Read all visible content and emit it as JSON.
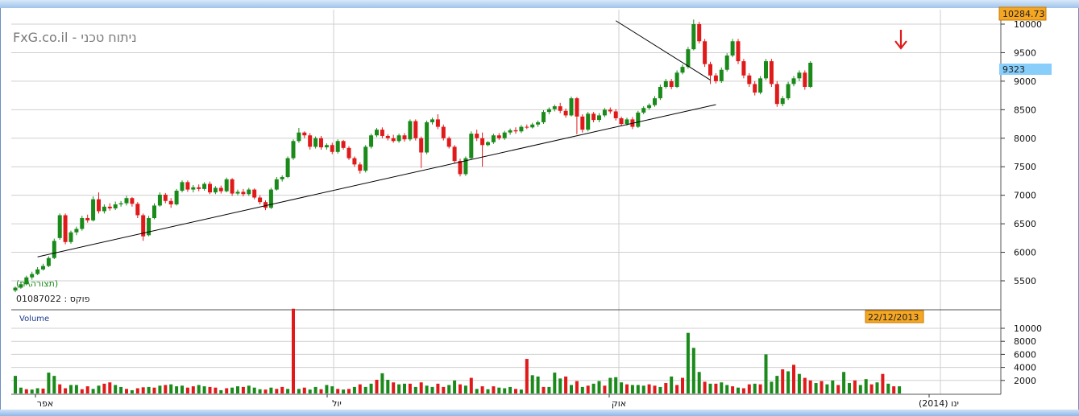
{
  "watermark": "FxG.co.il - ניתוח טכני",
  "price_tag": "10284.73",
  "last_value_tag": "9323",
  "date_tag": "22/12/2013",
  "legend_text": "(תצורה\\ית)",
  "symbol_line": "01087022 : פוקס",
  "volume_label": "Volume",
  "colors": {
    "up": "#1a8a1a",
    "down": "#e01a1a",
    "grid": "#cfcfcf",
    "tag_orange": "#f5a623",
    "tag_blue": "#87cefa",
    "arrow": "#e01a1a"
  },
  "chart_data": [
    {
      "type": "candlestick",
      "yticks": [
        5500,
        6000,
        6500,
        7000,
        7500,
        8000,
        8500,
        9000,
        9500,
        10000
      ],
      "ylim": [
        5000,
        10284.73
      ],
      "x_labels": [
        "אפר",
        "יול",
        "אוק",
        "(2014) ינו"
      ],
      "trendlines": [
        {
          "from": [
            4,
            5920
          ],
          "to": [
            126,
            8590
          ]
        },
        {
          "from": [
            108,
            10060
          ],
          "to": [
            125,
            9020
          ]
        }
      ],
      "candles": [
        [
          5330,
          5380,
          5300,
          5400
        ],
        [
          5380,
          5440,
          5360,
          5470
        ],
        [
          5440,
          5560,
          5420,
          5590
        ],
        [
          5560,
          5620,
          5520,
          5660
        ],
        [
          5620,
          5700,
          5600,
          5740
        ],
        [
          5700,
          5760,
          5680,
          5800
        ],
        [
          5760,
          5900,
          5740,
          5930
        ],
        [
          5900,
          6200,
          5880,
          6240
        ],
        [
          6250,
          6650,
          6220,
          6680
        ],
        [
          6650,
          6180,
          6140,
          6680
        ],
        [
          6180,
          6350,
          6150,
          6380
        ],
        [
          6350,
          6410,
          6300,
          6450
        ],
        [
          6410,
          6600,
          6380,
          6640
        ],
        [
          6600,
          6560,
          6520,
          6660
        ],
        [
          6560,
          6930,
          6540,
          6980
        ],
        [
          6930,
          6720,
          6680,
          7050
        ],
        [
          6720,
          6800,
          6680,
          6840
        ],
        [
          6800,
          6770,
          6730,
          6860
        ],
        [
          6770,
          6840,
          6740,
          6890
        ],
        [
          6840,
          6860,
          6800,
          6900
        ],
        [
          6860,
          6950,
          6820,
          6990
        ],
        [
          6950,
          6850,
          6800,
          6970
        ],
        [
          6850,
          6650,
          6600,
          6880
        ],
        [
          6650,
          6280,
          6200,
          6680
        ],
        [
          6300,
          6600,
          6280,
          6640
        ],
        [
          6600,
          6820,
          6580,
          6860
        ],
        [
          6820,
          7010,
          6800,
          7050
        ],
        [
          7010,
          6900,
          6860,
          7040
        ],
        [
          6900,
          6840,
          6780,
          6950
        ],
        [
          6840,
          7080,
          6820,
          7110
        ],
        [
          7080,
          7230,
          7050,
          7260
        ],
        [
          7230,
          7100,
          7060,
          7260
        ],
        [
          7100,
          7140,
          7050,
          7180
        ],
        [
          7140,
          7110,
          7070,
          7190
        ],
        [
          7110,
          7200,
          7080,
          7230
        ],
        [
          7200,
          7050,
          7020,
          7240
        ],
        [
          7050,
          7130,
          7020,
          7160
        ],
        [
          7130,
          7070,
          7030,
          7170
        ],
        [
          7070,
          7280,
          7050,
          7310
        ],
        [
          7280,
          7030,
          6990,
          7300
        ],
        [
          7030,
          7060,
          7000,
          7100
        ],
        [
          7060,
          7020,
          6980,
          7110
        ],
        [
          7020,
          7100,
          6990,
          7130
        ],
        [
          7100,
          6960,
          6930,
          7120
        ],
        [
          6960,
          6880,
          6840,
          7000
        ],
        [
          6880,
          6780,
          6740,
          6910
        ],
        [
          6780,
          7100,
          6760,
          7130
        ],
        [
          7100,
          7280,
          7080,
          7320
        ],
        [
          7280,
          7320,
          7240,
          7350
        ],
        [
          7320,
          7650,
          7300,
          7680
        ],
        [
          7650,
          7950,
          7620,
          7980
        ],
        [
          7950,
          8100,
          7920,
          8180
        ],
        [
          8100,
          8050,
          8000,
          8120
        ],
        [
          8050,
          7850,
          7800,
          8090
        ],
        [
          7850,
          8000,
          7820,
          8030
        ],
        [
          8000,
          7840,
          7800,
          8040
        ],
        [
          7840,
          7880,
          7800,
          7910
        ],
        [
          7880,
          7760,
          7720,
          7920
        ],
        [
          7760,
          7950,
          7730,
          7980
        ],
        [
          7950,
          7830,
          7800,
          7970
        ],
        [
          7830,
          7650,
          7620,
          7860
        ],
        [
          7650,
          7540,
          7500,
          7680
        ],
        [
          7540,
          7430,
          7380,
          7580
        ],
        [
          7430,
          7850,
          7400,
          7880
        ],
        [
          7850,
          8050,
          7820,
          8080
        ],
        [
          8050,
          8150,
          8020,
          8180
        ],
        [
          8150,
          8040,
          8000,
          8190
        ],
        [
          8040,
          8000,
          7960,
          8070
        ],
        [
          8000,
          7950,
          7920,
          8060
        ],
        [
          7950,
          8050,
          7920,
          8080
        ],
        [
          8050,
          7980,
          7940,
          8090
        ],
        [
          7980,
          8300,
          7950,
          8330
        ],
        [
          8300,
          8000,
          7960,
          8330
        ],
        [
          8000,
          7750,
          7480,
          8030
        ],
        [
          7750,
          8280,
          7720,
          8310
        ],
        [
          8280,
          8330,
          8240,
          8360
        ],
        [
          8330,
          8200,
          8160,
          8420
        ],
        [
          8200,
          8000,
          7960,
          8240
        ],
        [
          8000,
          7850,
          7820,
          8030
        ],
        [
          7850,
          7600,
          7560,
          7880
        ],
        [
          7600,
          7370,
          7330,
          7640
        ],
        [
          7370,
          7650,
          7340,
          7680
        ],
        [
          7650,
          8080,
          7620,
          8120
        ],
        [
          8080,
          8000,
          7950,
          8150
        ],
        [
          8000,
          7880,
          7500,
          8100
        ],
        [
          7880,
          7930,
          7860,
          7950
        ],
        [
          7930,
          8050,
          7900,
          8080
        ],
        [
          8050,
          8000,
          7970,
          8090
        ],
        [
          8000,
          8100,
          7970,
          8130
        ],
        [
          8100,
          8140,
          8060,
          8170
        ],
        [
          8140,
          8120,
          8080,
          8190
        ],
        [
          8120,
          8200,
          8090,
          8230
        ],
        [
          8200,
          8190,
          8160,
          8240
        ],
        [
          8190,
          8240,
          8170,
          8270
        ],
        [
          8240,
          8280,
          8200,
          8310
        ],
        [
          8280,
          8460,
          8250,
          8490
        ],
        [
          8460,
          8510,
          8420,
          8540
        ],
        [
          8510,
          8560,
          8470,
          8590
        ],
        [
          8560,
          8480,
          8440,
          8620
        ],
        [
          8480,
          8400,
          8360,
          8520
        ],
        [
          8400,
          8700,
          8380,
          8730
        ],
        [
          8700,
          8380,
          8070,
          8720
        ],
        [
          8380,
          8150,
          8100,
          8420
        ],
        [
          8150,
          8430,
          8120,
          8460
        ],
        [
          8430,
          8320,
          8280,
          8460
        ],
        [
          8320,
          8400,
          8280,
          8440
        ],
        [
          8400,
          8500,
          8370,
          8530
        ],
        [
          8500,
          8470,
          8430,
          8540
        ],
        [
          8470,
          8350,
          8310,
          8510
        ],
        [
          8350,
          8250,
          8210,
          8380
        ],
        [
          8250,
          8330,
          8220,
          8360
        ],
        [
          8330,
          8200,
          8160,
          8370
        ],
        [
          8200,
          8450,
          8180,
          8480
        ],
        [
          8450,
          8530,
          8420,
          8560
        ],
        [
          8530,
          8580,
          8500,
          8610
        ],
        [
          8580,
          8700,
          8550,
          8740
        ],
        [
          8700,
          8900,
          8670,
          8940
        ],
        [
          8900,
          9000,
          8870,
          9040
        ],
        [
          9000,
          8900,
          8860,
          9040
        ],
        [
          8900,
          9150,
          8880,
          9190
        ],
        [
          9150,
          9250,
          9120,
          9290
        ],
        [
          9250,
          9560,
          9220,
          9600
        ],
        [
          9560,
          10000,
          9540,
          10080
        ],
        [
          10000,
          9700,
          9660,
          10040
        ],
        [
          9700,
          9300,
          9250,
          9740
        ],
        [
          9300,
          9100,
          8950,
          9340
        ],
        [
          9100,
          9000,
          8960,
          9140
        ],
        [
          9000,
          9200,
          8970,
          9240
        ],
        [
          9200,
          9450,
          9170,
          9490
        ],
        [
          9450,
          9700,
          9420,
          9740
        ],
        [
          9700,
          9350,
          9300,
          9740
        ],
        [
          9350,
          9100,
          9050,
          9390
        ],
        [
          9100,
          8950,
          8900,
          9140
        ],
        [
          8950,
          8800,
          8750,
          9000
        ],
        [
          8800,
          9050,
          8770,
          9090
        ],
        [
          9050,
          9350,
          9020,
          9390
        ],
        [
          9350,
          8950,
          8900,
          9390
        ],
        [
          8950,
          8600,
          8550,
          9000
        ],
        [
          8600,
          8700,
          8560,
          8740
        ],
        [
          8700,
          8950,
          8670,
          8990
        ],
        [
          8950,
          9050,
          8910,
          9090
        ],
        [
          9050,
          9150,
          9000,
          9190
        ],
        [
          9150,
          8900,
          8850,
          9190
        ],
        [
          8900,
          9323,
          8880,
          9350
        ]
      ],
      "volume_yticks": [
        2000,
        4000,
        6000,
        8000,
        10000
      ],
      "volume_ylim": [
        0,
        12000
      ],
      "volume": [
        2700,
        900,
        650,
        600,
        800,
        750,
        3200,
        2700,
        1400,
        800,
        1300,
        1300,
        650,
        1100,
        700,
        1200,
        1500,
        1700,
        1300,
        1000,
        700,
        500,
        800,
        950,
        1000,
        900,
        1200,
        1300,
        1400,
        1100,
        1200,
        900,
        1100,
        1300,
        1100,
        1000,
        900,
        500,
        800,
        900,
        1100,
        1000,
        1200,
        900,
        650,
        600,
        900,
        700,
        1000,
        700,
        13000,
        700,
        900,
        600,
        1000,
        650,
        1300,
        1100,
        700,
        600,
        700,
        1000,
        1400,
        1000,
        1500,
        2100,
        3100,
        2100,
        1700,
        1400,
        1500,
        1500,
        1000,
        1700,
        1200,
        1000,
        1500,
        1000,
        1300,
        2000,
        1400,
        1200,
        2400,
        700,
        1100,
        650,
        1100,
        900,
        800,
        1000,
        700,
        600,
        5300,
        2800,
        2600,
        1000,
        1000,
        3200,
        2300,
        2600,
        1300,
        1900,
        1000,
        1200,
        1500,
        1900,
        1200,
        2400,
        2500,
        1700,
        1400,
        1300,
        1300,
        1200,
        1400,
        1200,
        1000,
        1600,
        2600,
        1300,
        2400,
        9300,
        7000,
        3300,
        1800,
        1500,
        1500,
        1700,
        1300,
        1100,
        900,
        800,
        1400,
        1500,
        1400,
        6000,
        1800,
        2700,
        3700,
        3400,
        4400,
        3000,
        2400,
        2000,
        1600,
        1900,
        1400,
        2000,
        1300,
        3300,
        1600,
        2000,
        1300,
        2200,
        1400,
        1700,
        3000,
        1500,
        1100,
        1100
      ],
      "volume_up_pattern": "1101101100110011001101001010111001100101101110100101011011010101101101101011001101010101110101101110101011011101110010100111010110100101110101001011011011010101"
    }
  ]
}
